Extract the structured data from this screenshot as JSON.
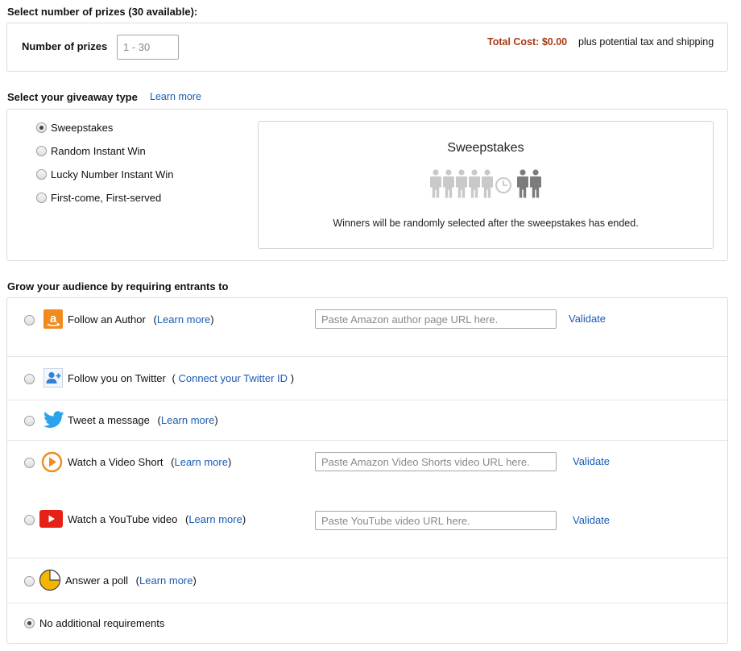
{
  "prizes": {
    "heading": "Select number of prizes (30 available):",
    "label": "Number of prizes",
    "input_placeholder": "1 - 30",
    "input_value": "",
    "total_cost_label": "Total Cost: $0.00",
    "total_note": "plus potential tax and shipping"
  },
  "giveaway": {
    "heading": "Select your giveaway type",
    "learn_more": "Learn more",
    "options": [
      {
        "label": "Sweepstakes",
        "selected": true
      },
      {
        "label": "Random Instant Win",
        "selected": false
      },
      {
        "label": "Lucky Number Instant Win",
        "selected": false
      },
      {
        "label": "First-come, First-served",
        "selected": false
      }
    ],
    "preview": {
      "title": "Sweepstakes",
      "description": "Winners will be randomly selected after the sweepstakes has ended.",
      "icon": "sweepstakes-people-clock-icon"
    }
  },
  "audience": {
    "heading": "Grow your audience by requiring entrants to",
    "items": [
      {
        "label": "Follow an Author",
        "pre": "(",
        "link": "Learn more",
        "post": ")",
        "icon": "amazon-icon",
        "placeholder": "Paste Amazon author page URL here.",
        "validate": "Validate",
        "selected": false
      },
      {
        "label": "Follow you on Twitter",
        "pre": "(",
        "link": "Connect your Twitter ID",
        "post": ")",
        "icon": "add-user-icon",
        "selected": false
      },
      {
        "label": "Tweet a message",
        "pre": "(",
        "link": "Learn more",
        "post": ")",
        "icon": "twitter-bird-icon",
        "selected": false
      },
      {
        "label": "Watch a Video Short",
        "pre": "(",
        "link": "Learn more",
        "post": ")",
        "icon": "video-play-icon",
        "placeholder": "Paste Amazon Video Shorts video URL here.",
        "validate": "Validate",
        "selected": false
      },
      {
        "label": "Watch a YouTube video",
        "pre": "(",
        "link": "Learn more",
        "post": ")",
        "icon": "youtube-icon",
        "placeholder": "Paste YouTube video URL here.",
        "validate": "Validate",
        "selected": false
      },
      {
        "label": "Answer a poll",
        "pre": "(",
        "link": "Learn more",
        "post": ")",
        "icon": "poll-pie-icon",
        "selected": false
      },
      {
        "label": "No additional requirements",
        "selected": true
      }
    ]
  },
  "colors": {
    "link": "#1a5bb5",
    "total_cost": "#a63a13",
    "amazon_orange": "#f08c1d",
    "twitter_blue": "#2aa3ef",
    "youtube_red": "#e62117",
    "poll_yellow": "#f6b600"
  }
}
